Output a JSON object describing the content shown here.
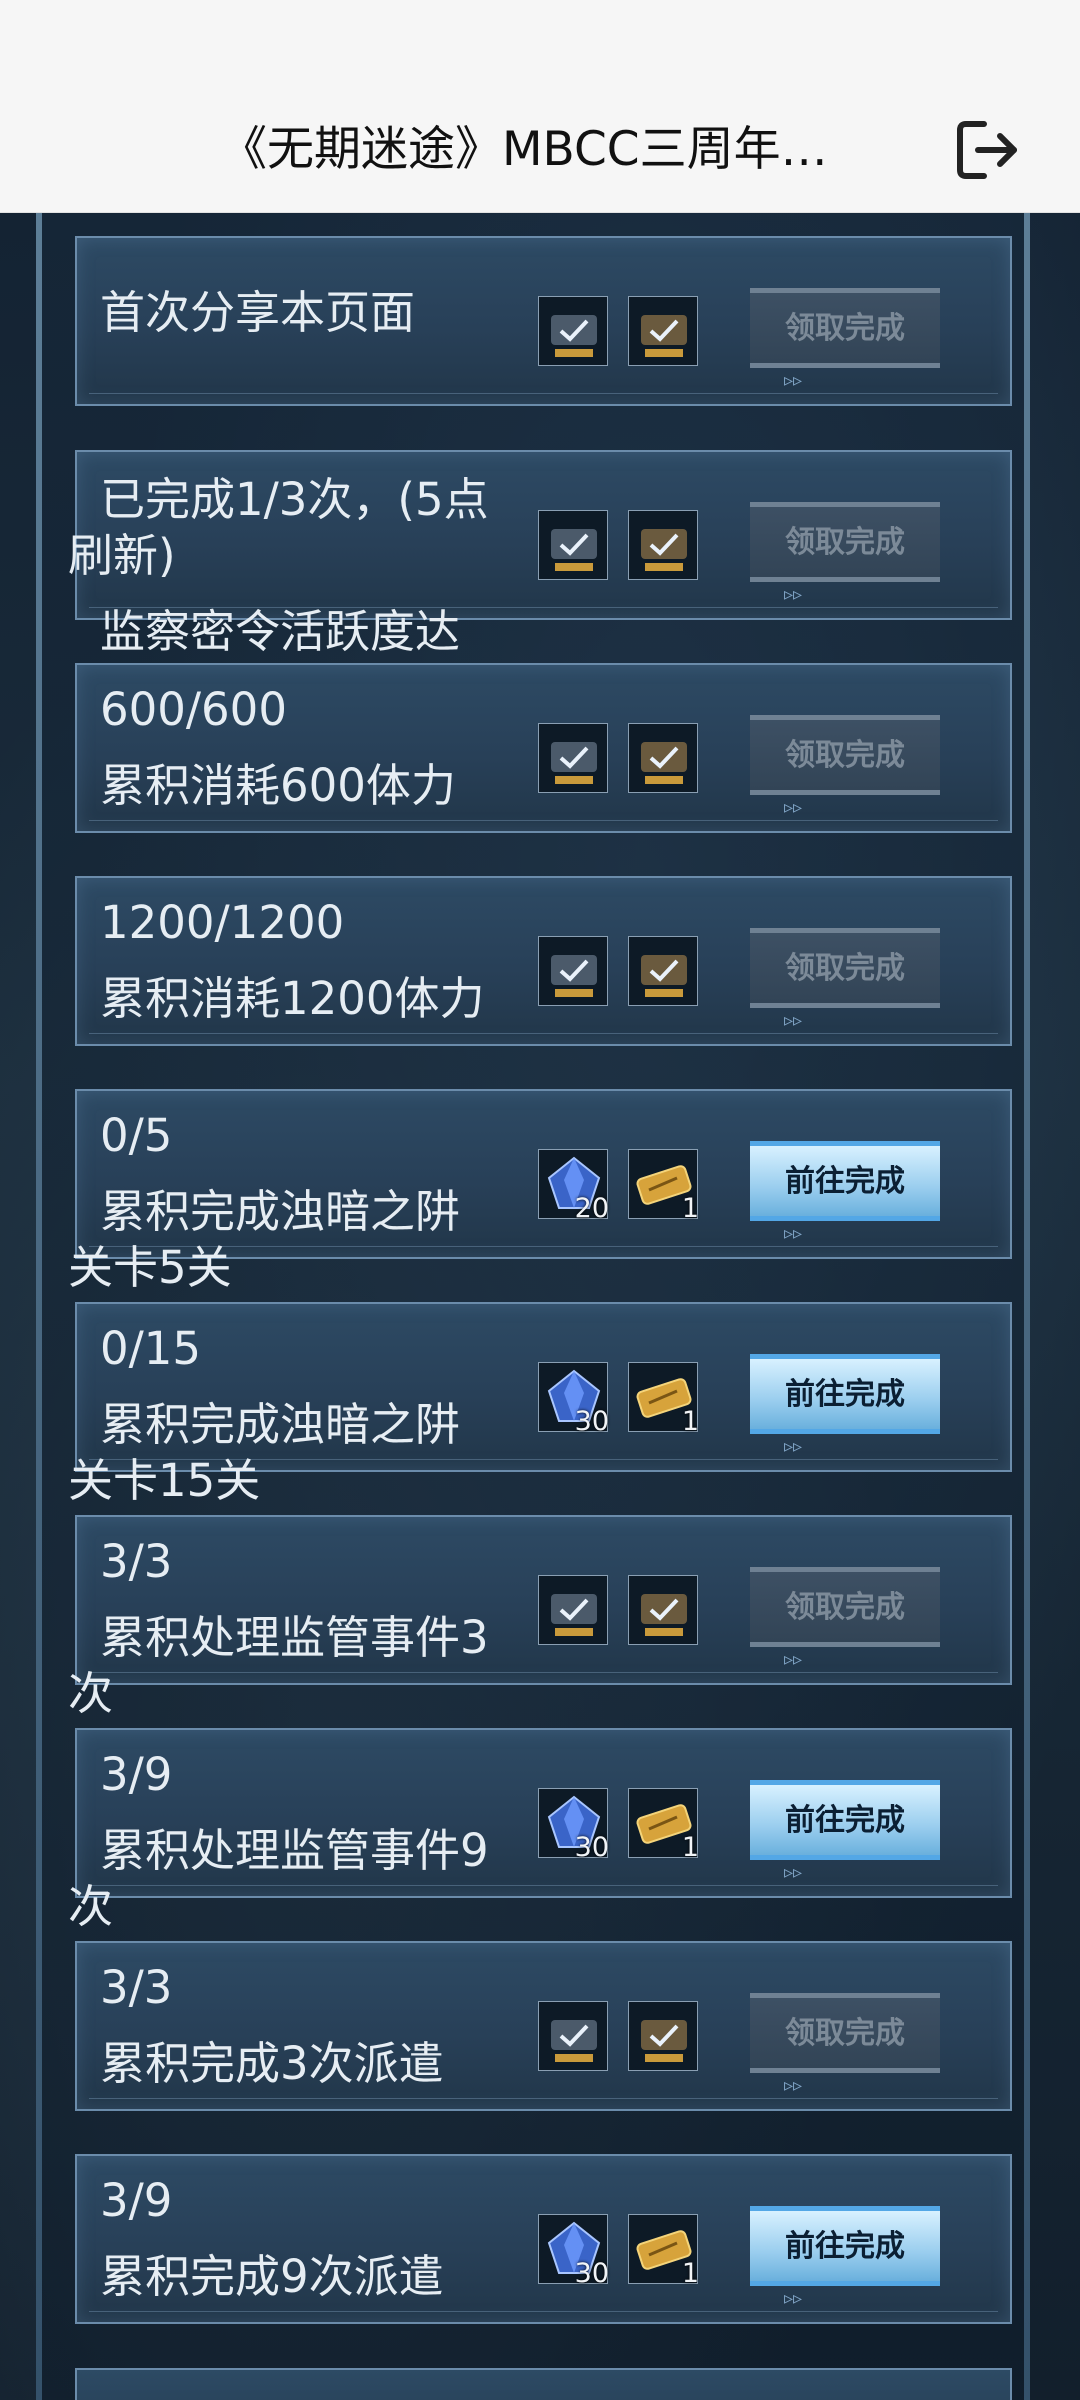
{
  "header": {
    "title": "《无期迷途》MBCC三周年…"
  },
  "labels": {
    "claimed": "领取完成",
    "go": "前往完成"
  },
  "tasks": [
    {
      "line1": "首次分享本页面",
      "line2": "",
      "wrap": "",
      "status": "claimed"
    },
    {
      "line1": "已完成1/3次，(5点",
      "line2": "",
      "wrap": "刷新)",
      "status": "claimed"
    },
    {
      "line1": "监察密令活跃度达",
      "line2": "600/600",
      "wrap": "",
      "line3": "累积消耗600体力",
      "status": "claimed"
    },
    {
      "line1": "1200/1200",
      "line2": "累积消耗1200体力",
      "wrap": "",
      "status": "claimed"
    },
    {
      "line1": "0/5",
      "line2": "累积完成浊暗之阱",
      "wrap": "关卡5关",
      "status": "go",
      "rewards": [
        "20",
        "1"
      ]
    },
    {
      "line1": "0/15",
      "line2": "累积完成浊暗之阱",
      "wrap": "关卡15关",
      "status": "go",
      "rewards": [
        "30",
        "1"
      ]
    },
    {
      "line1": "3/3",
      "line2": "累积处理监管事件3",
      "wrap": "次",
      "status": "claimed"
    },
    {
      "line1": "3/9",
      "line2": "累积处理监管事件9",
      "wrap": "次",
      "status": "go",
      "rewards": [
        "30",
        "1"
      ]
    },
    {
      "line1": "3/3",
      "line2": "累积完成3次派遣",
      "wrap": "",
      "status": "claimed"
    },
    {
      "line1": "3/9",
      "line2": "累积完成9次派遣",
      "wrap": "",
      "status": "go",
      "rewards": [
        "30",
        "1"
      ]
    }
  ],
  "icons": {
    "exit": "exit-icon",
    "crystal": "crystal-icon",
    "ticket": "ticket-icon",
    "claimed_check": "check-icon"
  },
  "colors": {
    "go_button": "#99cdee",
    "done_button": "#3d5064",
    "panel_border": "#6b8cab"
  }
}
